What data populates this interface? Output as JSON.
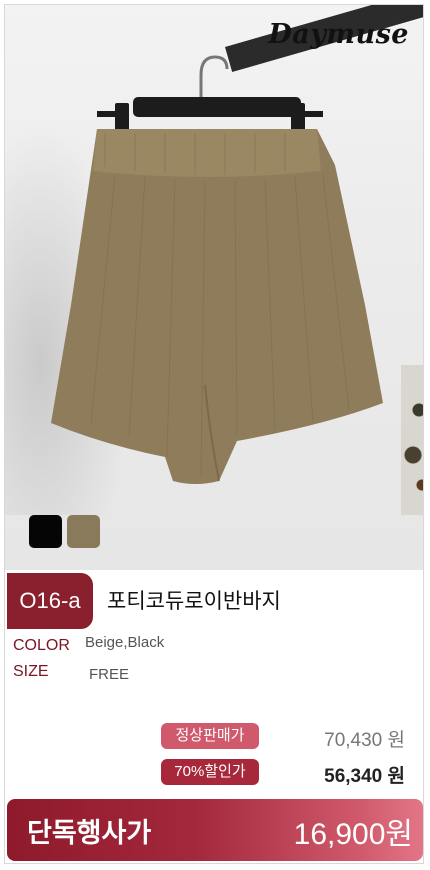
{
  "brand": {
    "name": "Daymuse"
  },
  "product": {
    "code": "O16-a",
    "name": "포티코듀로이반바지",
    "color_label": "COLOR",
    "color_value": "Beige,Black",
    "size_label": "SIZE",
    "size_value": "FREE",
    "swatches": [
      {
        "name": "Black",
        "color": "#050505"
      },
      {
        "name": "Beige",
        "color": "#8a7a5c"
      }
    ]
  },
  "pricing": {
    "regular_label": "정상판매가",
    "regular_price": "70,430 원",
    "discount_label": "70%할인가",
    "discount_price": "56,340 원",
    "exclusive_label": "단독행사가",
    "exclusive_price": "16,900원"
  },
  "colors": {
    "accent": "#8a1f2d",
    "pill_light": "#d05a6c",
    "pill_dark": "#a8283b"
  }
}
